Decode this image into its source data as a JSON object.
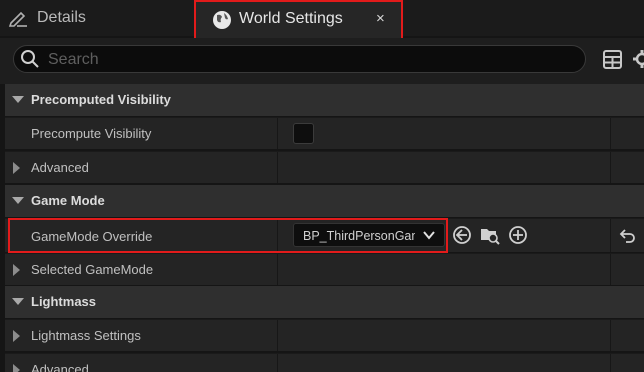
{
  "tabs": {
    "details": {
      "label": "Details",
      "icon": "pencil-icon"
    },
    "world_settings": {
      "label": "World Settings",
      "icon": "globe-icon",
      "close": "×"
    }
  },
  "search": {
    "placeholder": "Search"
  },
  "toolbar": {
    "view_options_icon": "table-icon",
    "settings_icon": "gear-icon"
  },
  "sections": {
    "precomputed_visibility": {
      "label": "Precomputed Visibility",
      "precompute_visibility": {
        "label": "Precompute Visibility",
        "checked": false
      },
      "advanced": {
        "label": "Advanced"
      }
    },
    "game_mode": {
      "label": "Game Mode",
      "gamemode_override": {
        "label": "GameMode Override",
        "value": "BP_ThirdPersonGameMode"
      },
      "selected_gamemode": {
        "label": "Selected GameMode"
      }
    },
    "lightmass": {
      "label": "Lightmass",
      "lightmass_settings": {
        "label": "Lightmass Settings"
      },
      "advanced": {
        "label": "Advanced"
      }
    }
  },
  "colors": {
    "highlight": "#e21b1b",
    "background": "#151515"
  }
}
